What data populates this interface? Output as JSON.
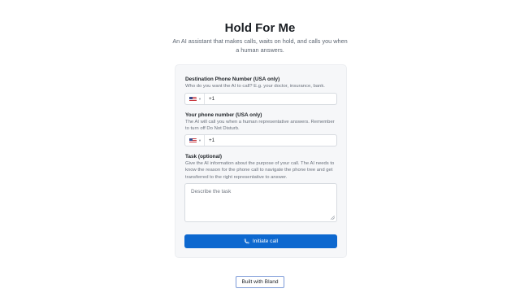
{
  "header": {
    "title": "Hold For Me",
    "subtitle": "An AI assistant that makes calls, waits on hold, and calls you when a human answers."
  },
  "form": {
    "destination": {
      "label": "Destination Phone Number (USA only)",
      "help": "Who do you want the AI to call? E.g. your doctor, insurance, bank.",
      "country_flag": "us-flag-icon",
      "dial_code": "+1"
    },
    "your_phone": {
      "label": "Your phone number (USA only)",
      "help": "The AI will call you when a human representative answers. Remember to turn off Do Not Disturb.",
      "country_flag": "us-flag-icon",
      "dial_code": "+1"
    },
    "task": {
      "label": "Task (optional)",
      "help": "Give the AI information about the purpose of your call. The AI needs to know the reason for the phone call to navigate the phone tree and get transferred to the right representative to answer.",
      "placeholder": "Describe the task"
    },
    "submit": {
      "label": "Initiate call",
      "icon": "phone-icon",
      "color": "#0d68cf"
    }
  },
  "footer": {
    "built_with_label": "Built with Bland"
  }
}
